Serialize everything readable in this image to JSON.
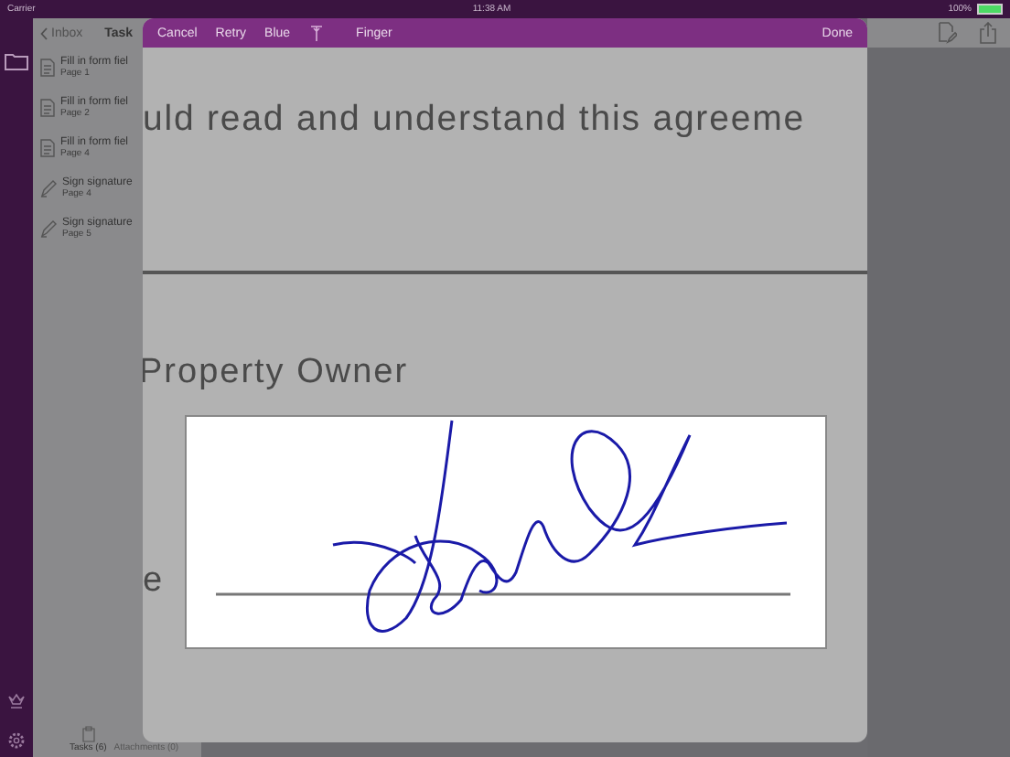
{
  "status_bar": {
    "carrier": "Carrier",
    "time": "11:38 AM",
    "battery": "100%"
  },
  "task_list": {
    "back": "Inbox",
    "title": "Task",
    "items": [
      {
        "kind": "form",
        "title": "Fill in form fiel",
        "subtitle": "Page 1"
      },
      {
        "kind": "form",
        "title": "Fill in form fiel",
        "subtitle": "Page 2"
      },
      {
        "kind": "form",
        "title": "Fill in form fiel",
        "subtitle": "Page 4"
      },
      {
        "kind": "signature",
        "title": "Sign signature",
        "subtitle": "Page 4"
      },
      {
        "kind": "signature",
        "title": "Sign signature",
        "subtitle": "Page 5"
      }
    ]
  },
  "bottom_tabs": [
    {
      "label": "Tasks (6)",
      "selected": true
    },
    {
      "label": "Attachments (0)",
      "selected": false
    }
  ],
  "signature_sheet": {
    "toolbar": {
      "cancel": "Cancel",
      "retry": "Retry",
      "ink_option": "Blue",
      "tool": "Finger",
      "done": "Done"
    },
    "document": {
      "line_1": "uld read and understand this agreeme",
      "label": "Property Owner",
      "line_label": "e"
    }
  }
}
